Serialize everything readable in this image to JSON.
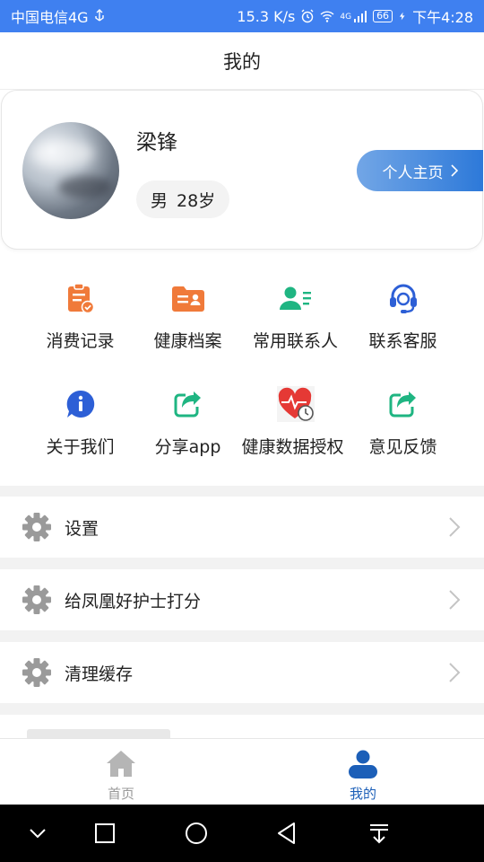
{
  "status_bar": {
    "carrier": "中国电信4G",
    "net_speed": "15.3 K/s",
    "network_type": "4G",
    "battery": "66",
    "time": "下午4:28",
    "bg_color": "#3f80f0"
  },
  "header": {
    "title": "我的"
  },
  "profile": {
    "name": "梁锋",
    "gender": "男",
    "age": "28岁",
    "homepage_button": "个人主页"
  },
  "grid": {
    "items": [
      {
        "label": "消费记录",
        "icon": "clipboard-check-icon",
        "color": "#f07a3a"
      },
      {
        "label": "健康档案",
        "icon": "id-card-folder-icon",
        "color": "#f07a3a"
      },
      {
        "label": "常用联系人",
        "icon": "contact-list-icon",
        "color": "#1fb582"
      },
      {
        "label": "联系客服",
        "icon": "headset-icon",
        "color": "#2d5fd6"
      },
      {
        "label": "关于我们",
        "icon": "info-bubble-icon",
        "color": "#2d5fd6"
      },
      {
        "label": "分享app",
        "icon": "share-icon",
        "color": "#1fb582"
      },
      {
        "label": "健康数据授权",
        "icon": "health-data-icon",
        "color": "#e53935"
      },
      {
        "label": "意见反馈",
        "icon": "feedback-share-icon",
        "color": "#1fb582"
      }
    ]
  },
  "list": {
    "items": [
      {
        "label": "设置",
        "icon": "gear-icon"
      },
      {
        "label": "给凤凰好护士打分",
        "icon": "gear-icon"
      },
      {
        "label": "清理缓存",
        "icon": "gear-icon"
      }
    ]
  },
  "tab_bar": {
    "tabs": [
      {
        "label": "首页",
        "icon": "home-icon",
        "active": false
      },
      {
        "label": "我的",
        "icon": "person-icon",
        "active": true
      }
    ],
    "active_color": "#1c5fb8",
    "inactive_color": "#999999"
  },
  "nav_bar": {
    "buttons": [
      "collapse-icon",
      "recents-icon",
      "home-circle-icon",
      "back-icon",
      "notification-pull-icon"
    ]
  }
}
